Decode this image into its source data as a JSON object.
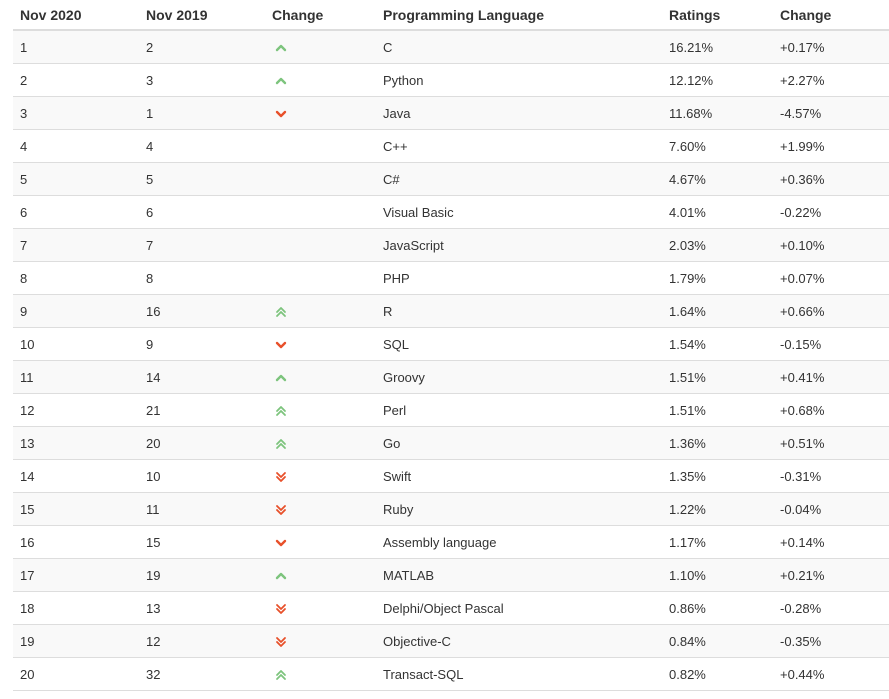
{
  "headers": [
    "Nov 2020",
    "Nov 2019",
    "Change",
    "Programming Language",
    "Ratings",
    "Change"
  ],
  "colors": {
    "up": "#7dc47d",
    "down": "#e8502a"
  },
  "rows": [
    {
      "nov2020": "1",
      "nov2019": "2",
      "trend": "up",
      "language": "C",
      "rating": "16.21%",
      "change": "+0.17%"
    },
    {
      "nov2020": "2",
      "nov2019": "3",
      "trend": "up",
      "language": "Python",
      "rating": "12.12%",
      "change": "+2.27%"
    },
    {
      "nov2020": "3",
      "nov2019": "1",
      "trend": "down",
      "language": "Java",
      "rating": "11.68%",
      "change": "-4.57%"
    },
    {
      "nov2020": "4",
      "nov2019": "4",
      "trend": "none",
      "language": "C++",
      "rating": "7.60%",
      "change": "+1.99%"
    },
    {
      "nov2020": "5",
      "nov2019": "5",
      "trend": "none",
      "language": "C#",
      "rating": "4.67%",
      "change": "+0.36%"
    },
    {
      "nov2020": "6",
      "nov2019": "6",
      "trend": "none",
      "language": "Visual Basic",
      "rating": "4.01%",
      "change": "-0.22%"
    },
    {
      "nov2020": "7",
      "nov2019": "7",
      "trend": "none",
      "language": "JavaScript",
      "rating": "2.03%",
      "change": "+0.10%"
    },
    {
      "nov2020": "8",
      "nov2019": "8",
      "trend": "none",
      "language": "PHP",
      "rating": "1.79%",
      "change": "+0.07%"
    },
    {
      "nov2020": "9",
      "nov2019": "16",
      "trend": "up2",
      "language": "R",
      "rating": "1.64%",
      "change": "+0.66%"
    },
    {
      "nov2020": "10",
      "nov2019": "9",
      "trend": "down",
      "language": "SQL",
      "rating": "1.54%",
      "change": "-0.15%"
    },
    {
      "nov2020": "11",
      "nov2019": "14",
      "trend": "up",
      "language": "Groovy",
      "rating": "1.51%",
      "change": "+0.41%"
    },
    {
      "nov2020": "12",
      "nov2019": "21",
      "trend": "up2",
      "language": "Perl",
      "rating": "1.51%",
      "change": "+0.68%"
    },
    {
      "nov2020": "13",
      "nov2019": "20",
      "trend": "up2",
      "language": "Go",
      "rating": "1.36%",
      "change": "+0.51%"
    },
    {
      "nov2020": "14",
      "nov2019": "10",
      "trend": "down2",
      "language": "Swift",
      "rating": "1.35%",
      "change": "-0.31%"
    },
    {
      "nov2020": "15",
      "nov2019": "11",
      "trend": "down2",
      "language": "Ruby",
      "rating": "1.22%",
      "change": "-0.04%"
    },
    {
      "nov2020": "16",
      "nov2019": "15",
      "trend": "down",
      "language": "Assembly language",
      "rating": "1.17%",
      "change": "+0.14%"
    },
    {
      "nov2020": "17",
      "nov2019": "19",
      "trend": "up",
      "language": "MATLAB",
      "rating": "1.10%",
      "change": "+0.21%"
    },
    {
      "nov2020": "18",
      "nov2019": "13",
      "trend": "down2",
      "language": "Delphi/Object Pascal",
      "rating": "0.86%",
      "change": "-0.28%"
    },
    {
      "nov2020": "19",
      "nov2019": "12",
      "trend": "down2",
      "language": "Objective-C",
      "rating": "0.84%",
      "change": "-0.35%"
    },
    {
      "nov2020": "20",
      "nov2019": "32",
      "trend": "up2",
      "language": "Transact-SQL",
      "rating": "0.82%",
      "change": "+0.44%"
    }
  ]
}
